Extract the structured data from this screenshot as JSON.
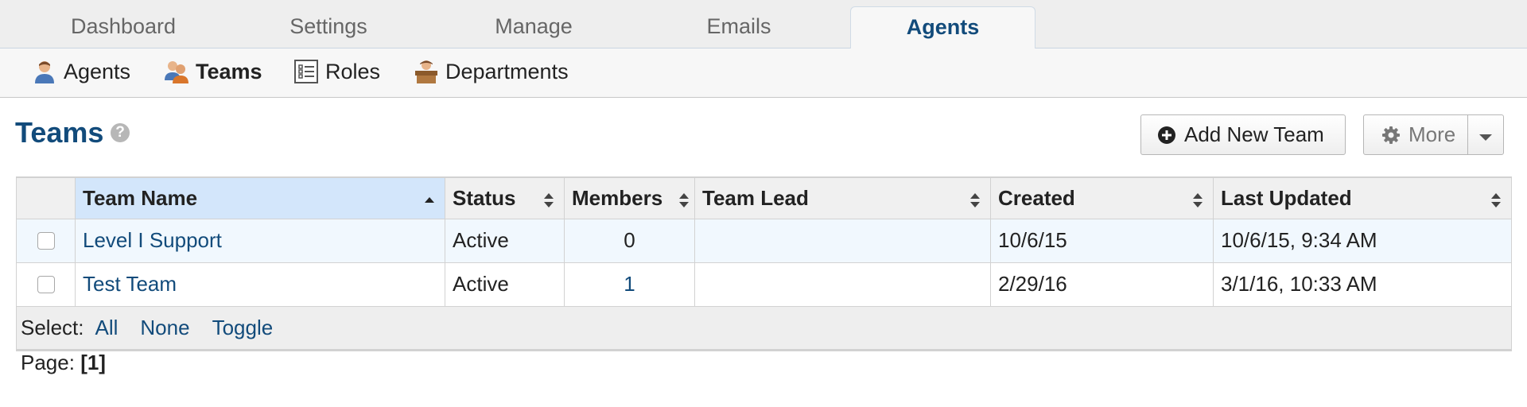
{
  "topnav": {
    "tabs": [
      {
        "label": "Dashboard"
      },
      {
        "label": "Settings"
      },
      {
        "label": "Manage"
      },
      {
        "label": "Emails"
      },
      {
        "label": "Agents"
      }
    ],
    "active": "Agents"
  },
  "subnav": {
    "items": [
      {
        "label": "Agents",
        "icon": "agent-icon"
      },
      {
        "label": "Teams",
        "icon": "teams-icon"
      },
      {
        "label": "Roles",
        "icon": "roles-icon"
      },
      {
        "label": "Departments",
        "icon": "departments-icon"
      }
    ],
    "active": "Teams"
  },
  "page": {
    "title": "Teams",
    "help_icon": "question-circle-icon",
    "help_glyph": "?",
    "add_button": "Add New Team",
    "more_button": "More"
  },
  "table": {
    "columns": [
      "Team Name",
      "Status",
      "Members",
      "Team Lead",
      "Created",
      "Last Updated"
    ],
    "sorted_column": "Team Name",
    "sort_direction": "ascending",
    "rows": [
      {
        "name": "Level I Support",
        "status": "Active",
        "members": "0",
        "lead": "",
        "created": "10/6/15",
        "updated": "10/6/15, 9:34 AM"
      },
      {
        "name": "Test Team",
        "status": "Active",
        "members": "1",
        "lead": "",
        "created": "2/29/16",
        "updated": "3/1/16, 10:33 AM"
      }
    ],
    "select_label": "Select:",
    "select_all": "All",
    "select_none": "None",
    "select_toggle": "Toggle"
  },
  "pager": {
    "label": "Page:",
    "current": "[1]"
  },
  "colors": {
    "accent": "#124b7b",
    "header_sorted": "#d3e6fb",
    "row_alt": "#f1f8fe"
  }
}
